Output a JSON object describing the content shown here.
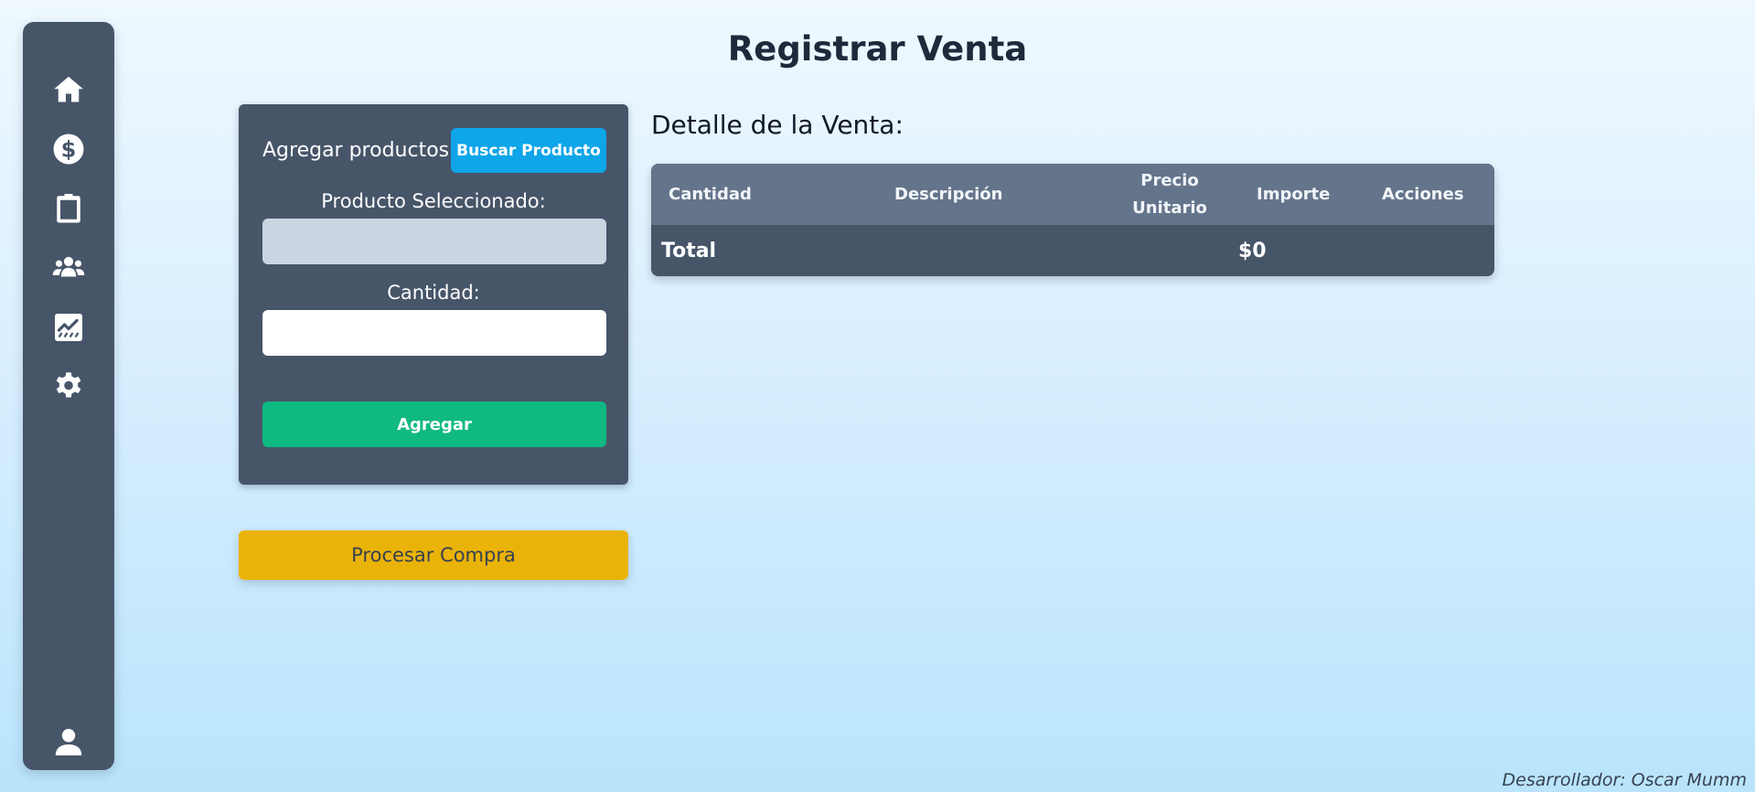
{
  "sidebar": {
    "items": [
      {
        "icon": "home-icon",
        "label": "home"
      },
      {
        "icon": "dollar-icon",
        "label": "sales"
      },
      {
        "icon": "clipboard-icon",
        "label": "inventory"
      },
      {
        "icon": "users-icon",
        "label": "customers"
      },
      {
        "icon": "chart-icon",
        "label": "reports"
      },
      {
        "icon": "gear-icon",
        "label": "settings"
      }
    ],
    "bottom_icon": "user-icon"
  },
  "page": {
    "title": "Registrar Venta"
  },
  "form": {
    "add_products_label": "Agregar productos:",
    "search_button": "Buscar Producto",
    "selected_product_label": "Producto Seleccionado:",
    "selected_product_value": "",
    "quantity_label": "Cantidad:",
    "quantity_value": "",
    "add_button": "Agregar"
  },
  "process_button": "Procesar Compra",
  "detail": {
    "title": "Detalle de la Venta:",
    "columns": {
      "quantity": "Cantidad",
      "description": "Descripción",
      "unit_price_line1": "Precio",
      "unit_price_line2": "Unitario",
      "amount": "Importe",
      "actions": "Acciones"
    },
    "rows": [],
    "total_label": "Total",
    "total_value": "$0"
  },
  "footer": {
    "credit": "Desarrollador: Oscar Mumm"
  },
  "colors": {
    "sidebar": "#475569",
    "panel": "#475569",
    "table_header": "#64748b",
    "search_button": "#0ea5e9",
    "add_button": "#10b981",
    "process_button": "#eab308"
  }
}
